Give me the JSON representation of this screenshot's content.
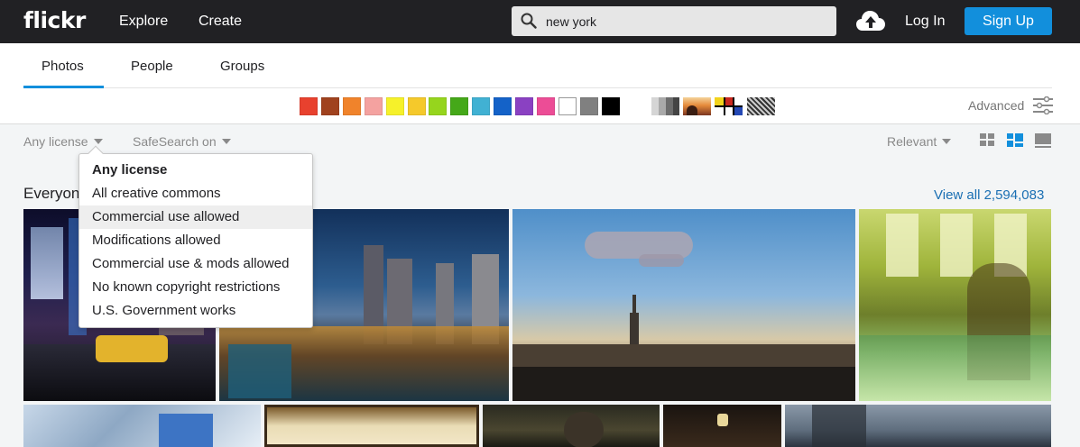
{
  "nav": {
    "logo": "flickr",
    "explore": "Explore",
    "create": "Create",
    "search_value": "new york",
    "login": "Log In",
    "signup": "Sign Up"
  },
  "tabs": [
    {
      "label": "Photos",
      "active": true
    },
    {
      "label": "People",
      "active": false
    },
    {
      "label": "Groups",
      "active": false
    }
  ],
  "color_swatches": [
    "#e8412e",
    "#a0421e",
    "#f0832b",
    "#f4a2a0",
    "#f6f12a",
    "#f5c92b",
    "#96d51d",
    "#45a819",
    "#41b1d3",
    "#1462c8",
    "#8a41c2",
    "#ec4d96",
    "#ffffff",
    "#808080",
    "#000000"
  ],
  "style_swatches": [
    "black-and-white",
    "shallow-depth-of-field",
    "minimalist",
    "patterns"
  ],
  "advanced_label": "Advanced",
  "filters": {
    "license": "Any license",
    "safesearch": "SafeSearch on",
    "sort": "Relevant"
  },
  "license_menu": [
    "Any license",
    "All creative commons",
    "Commercial use allowed",
    "Modifications allowed",
    "Commercial use & mods allowed",
    "No known copyright restrictions",
    "U.S. Government works"
  ],
  "section": {
    "title": "Everyone",
    "view_all": "View all 2,594,083"
  },
  "accent_color": "#128fdc"
}
